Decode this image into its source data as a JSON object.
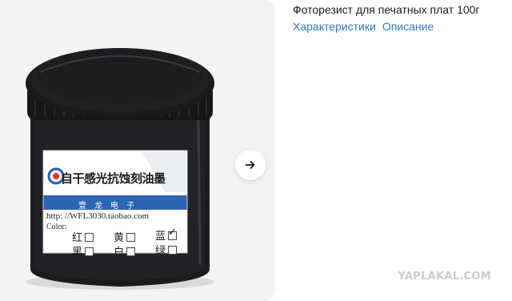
{
  "product": {
    "title": "Фоторезист для печатных плат 100г",
    "tabs": [
      "Характеристики",
      "Описание"
    ]
  },
  "gallery": {
    "next_icon": "arrow-right-icon",
    "label": {
      "brand_text": "自干感光抗蚀刻油墨",
      "sub_brand": "壹龙电子",
      "website": "http: //WFL3030.taobao.com",
      "color_caption": "Color:",
      "options": [
        {
          "name": "红",
          "checked": false
        },
        {
          "name": "黄",
          "checked": false
        },
        {
          "name": "蓝",
          "checked": true
        },
        {
          "name": "黑",
          "checked": false
        },
        {
          "name": "白",
          "checked": false
        },
        {
          "name": "绿",
          "checked": false
        }
      ]
    }
  },
  "watermark": "YAPLAKAL.COM",
  "colors": {
    "link": "#2f78c4",
    "gallery_bg": "#f3f3f4",
    "jar": "#1b1b1d",
    "label_stripe": "#2d64b4"
  }
}
